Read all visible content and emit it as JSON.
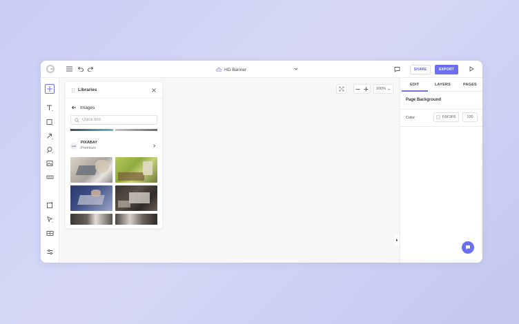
{
  "app": {
    "document_title": "HD Banner"
  },
  "topbar": {
    "share_label": "SHARE",
    "export_label": "EXPORT",
    "icons": [
      "logo-icon",
      "menu-icon",
      "undo-icon",
      "redo-icon",
      "cloud-icon",
      "chevron-down-icon",
      "comment-icon",
      "play-icon"
    ]
  },
  "leftbar": {
    "icons": [
      "add-icon",
      "text-icon",
      "shape-icon",
      "arrow-icon",
      "pen-icon",
      "image-icon",
      "table-icon",
      "frame-icon",
      "select-icon",
      "grid-icon",
      "settings-icon"
    ]
  },
  "libraries": {
    "title": "Libraries",
    "section_label": "Images",
    "search_placeholder": "Quick find",
    "provider": {
      "name": "PIXABAY",
      "tier": "Premium",
      "logo_text": "pxb"
    }
  },
  "canvas": {
    "zoom": "100%"
  },
  "rightpanel": {
    "tabs": [
      "EDIT",
      "LAYERS",
      "PAGES"
    ],
    "active_tab": "EDIT",
    "section_title": "Page Background",
    "color_label": "Color",
    "color_value": "F6F3F6",
    "opacity_value": "100"
  },
  "colors": {
    "accent": "#6b6ff1",
    "background_gradient": "#c9cdf3",
    "canvas_bg": "#f7f7f8"
  }
}
